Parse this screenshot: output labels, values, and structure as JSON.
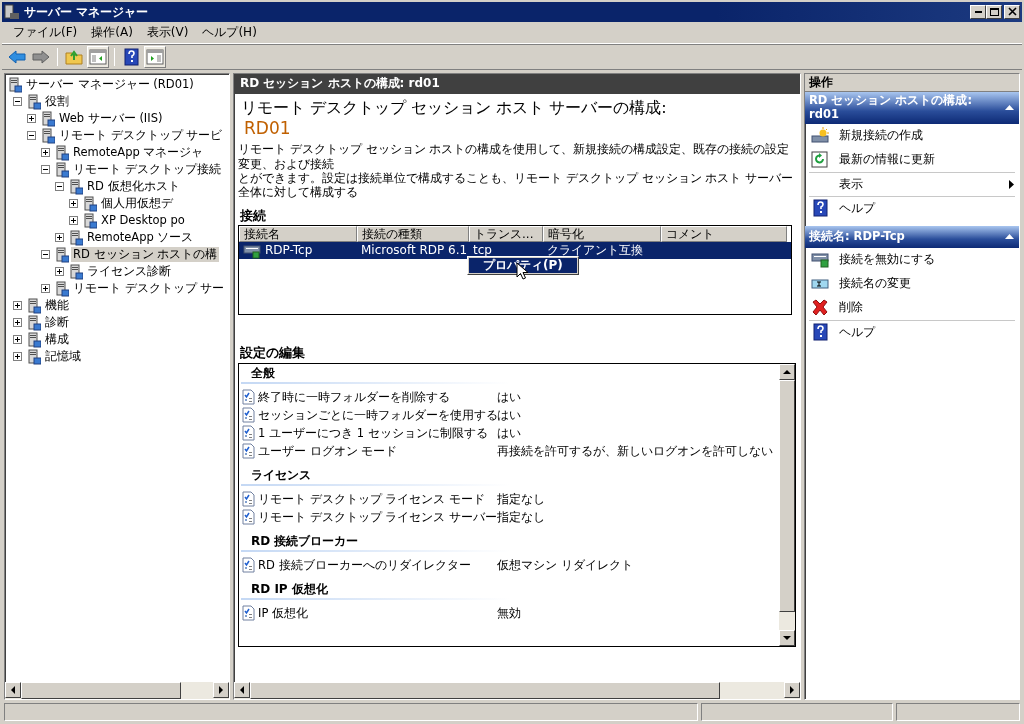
{
  "window": {
    "title": "サーバー マネージャー"
  },
  "menu": [
    "ファイル(F)",
    "操作(A)",
    "表示(V)",
    "ヘルプ(H)"
  ],
  "toolbar": [
    {
      "kind": "back",
      "pressed": false
    },
    {
      "kind": "forward",
      "pressed": false
    },
    {
      "kind": "up",
      "pressed": false
    },
    {
      "kind": "tree",
      "pressed": true
    },
    {
      "kind": "help",
      "pressed": false
    },
    {
      "kind": "actions",
      "pressed": true
    }
  ],
  "tree": [
    {
      "label": "サーバー マネージャー (RD01)",
      "selected": false,
      "children": [
        {
          "label": "役割",
          "expanded": true,
          "selected": false,
          "children": [
            {
              "label": "Web サーバー (IIS)",
              "expanded": false,
              "selected": false
            },
            {
              "label": "リモート デスクトップ サービ",
              "expanded": true,
              "selected": false,
              "children": [
                {
                  "label": "RemoteApp マネージャ",
                  "expanded": false,
                  "selected": false
                },
                {
                  "label": "リモート デスクトップ接続",
                  "expanded": true,
                  "selected": false,
                  "children": [
                    {
                      "label": "RD 仮想化ホスト",
                      "expanded": true,
                      "selected": false,
                      "children": [
                        {
                          "label": "個人用仮想デ",
                          "expanded": false,
                          "selected": false
                        },
                        {
                          "label": "XP Desktop po",
                          "expanded": false,
                          "selected": false
                        }
                      ]
                    },
                    {
                      "label": "RemoteApp ソース",
                      "expanded": false,
                      "selected": false
                    }
                  ]
                },
                {
                  "label": "RD セッション ホストの構",
                  "expanded": true,
                  "selected": true,
                  "children": [
                    {
                      "label": "ライセンス診断",
                      "expanded": false,
                      "selected": false
                    }
                  ]
                },
                {
                  "label": "リモート デスクトップ サー",
                  "expanded": false,
                  "selected": false
                }
              ]
            }
          ]
        },
        {
          "label": "機能",
          "expanded": false,
          "selected": false
        },
        {
          "label": "診断",
          "expanded": false,
          "selected": false
        },
        {
          "label": "構成",
          "expanded": false,
          "selected": false
        },
        {
          "label": "記憶域",
          "expanded": false,
          "selected": false
        }
      ]
    }
  ],
  "center": {
    "header": "RD セッション ホストの構成: rd01",
    "title": "リモート デスクトップ セッション ホスト サーバーの構成:",
    "server": "RD01",
    "description": [
      "リモート デスクトップ セッション ホストの構成を使用して、新規接続の構成設定、既存の接続の設定変更、および接続",
      "とができます。設定は接続単位で構成することも、リモート デスクトップ セッション ホスト サーバー全体に対して構成する"
    ],
    "connections": {
      "label": "接続",
      "columns": [
        "接続名",
        "接続の種類",
        "トランス...",
        "暗号化",
        "コメント"
      ],
      "rows": [
        {
          "cells": [
            "RDP-Tcp",
            "Microsoft RDP 6.1",
            "tcp",
            "クライアント互換"
          ],
          "selected": true
        }
      ],
      "context_menu": {
        "items": [
          {
            "label": "プロパティ(P)",
            "selected": true
          }
        ]
      }
    },
    "settings": {
      "label": "設定の編集",
      "groups": [
        {
          "title": "全般",
          "items": [
            {
              "name": "終了時に一時フォルダーを削除する",
              "value": "はい"
            },
            {
              "name": "セッションごとに一時フォルダーを使用する",
              "value": "はい"
            },
            {
              "name": "1 ユーザーにつき 1 セッションに制限する",
              "value": "はい"
            },
            {
              "name": "ユーザー ログオン モード",
              "value": "再接続を許可するが、新しいログオンを許可しない"
            }
          ]
        },
        {
          "title": "ライセンス",
          "items": [
            {
              "name": "リモート デスクトップ ライセンス モード",
              "value": "指定なし"
            },
            {
              "name": "リモート デスクトップ ライセンス サーバー",
              "value": "指定なし"
            }
          ]
        },
        {
          "title": "RD 接続ブローカー",
          "items": [
            {
              "name": "RD 接続ブローカーへのリダイレクター",
              "value": "仮想マシン リダイレクト"
            }
          ]
        },
        {
          "title": "RD IP 仮想化",
          "items": [
            {
              "name": "IP 仮想化",
              "value": "無効"
            }
          ]
        }
      ]
    }
  },
  "actions": {
    "title": "操作",
    "sections": [
      {
        "title": "RD セッション ホストの構成: rd01",
        "expanded": true,
        "items": [
          {
            "label": "新規接続の作成",
            "kind": "new"
          },
          {
            "label": "最新の情報に更新",
            "kind": "refresh"
          },
          {
            "label": "表示",
            "kind": "view",
            "submenu": true
          },
          {
            "label": "ヘルプ",
            "kind": "help"
          }
        ]
      },
      {
        "title": "接続名: RDP-Tcp",
        "expanded": true,
        "items": [
          {
            "label": "接続を無効にする",
            "kind": "disable"
          },
          {
            "label": "接続名の変更",
            "kind": "rename"
          },
          {
            "label": "削除",
            "kind": "delete"
          },
          {
            "label": "ヘルプ",
            "kind": "help"
          }
        ]
      }
    ]
  }
}
